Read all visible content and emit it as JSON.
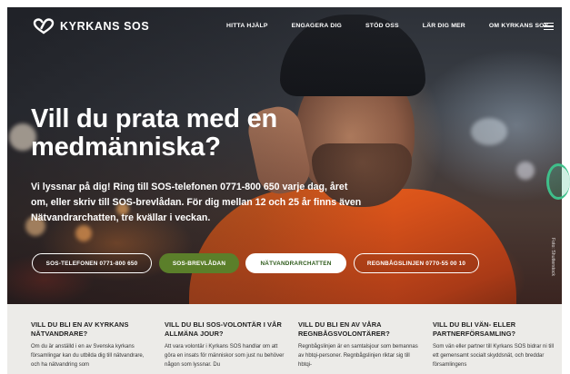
{
  "brand": {
    "name": "KYRKANS SOS",
    "colors": {
      "green": "#5b7f2a",
      "band": "#ecebe8",
      "text_dark": "#1e1e1e",
      "accent_ring": "#3fbf8a"
    }
  },
  "nav": {
    "links": [
      "HITTA HJÄLP",
      "ENGAGERA DIG",
      "STÖD OSS",
      "LÄR DIG MER",
      "OM KYRKANS SOS"
    ],
    "menu_icon": "hamburger-icon"
  },
  "hero": {
    "title": "Vill du prata med en medmänniska?",
    "body": "Vi lyssnar på dig! Ring till SOS-telefonen 0771-800 650 varje dag, året om, eller skriv till SOS-brevlådan. För dig mellan 12 och 25 år finns även Nätvandrarchatten, tre kvällar i veckan.",
    "photo_credit": "Foto: Shutterstock",
    "buttons": {
      "phone": "SOS-TELEFONEN 0771-800 650",
      "mailbox": "SOS-BREVLÅDAN",
      "chat": "NÄTVANDRARCHATTEN",
      "rainbow": "REGNBÅGSLINJEN 0770-55 00 10"
    }
  },
  "columns": [
    {
      "title": "VILL DU BLI EN AV KYRKANS NÄTVANDRARE?",
      "text": "Om du är anställd i en av Svenska kyrkans församlingar kan du utbilda dig till nätvandrare, och ha nätvandring som"
    },
    {
      "title": "VILL DU BLI SOS-VOLONTÄR I VÅR ALLMÄNA JOUR?",
      "text": "Att vara volontär i Kyrkans SOS handlar om att göra en insats för människor som just nu behöver någon som lyssnar. Du"
    },
    {
      "title": "VILL DU BLI EN AV VÅRA REGNBÅGSVOLONTÄRER?",
      "text": "Regnbågslinjen är en samtalsjour som bemannas av hbtqi-personer. Regnbågslinjen riktar sig till hbtqi-"
    },
    {
      "title": "VILL DU BLI VÄN- ELLER PARTNERFÖRSAMLING?",
      "text": "Som vän eller partner till Kyrkans SOS bidrar ni till ett gemensamt socialt skyddsnät, och breddar församlingens"
    }
  ]
}
